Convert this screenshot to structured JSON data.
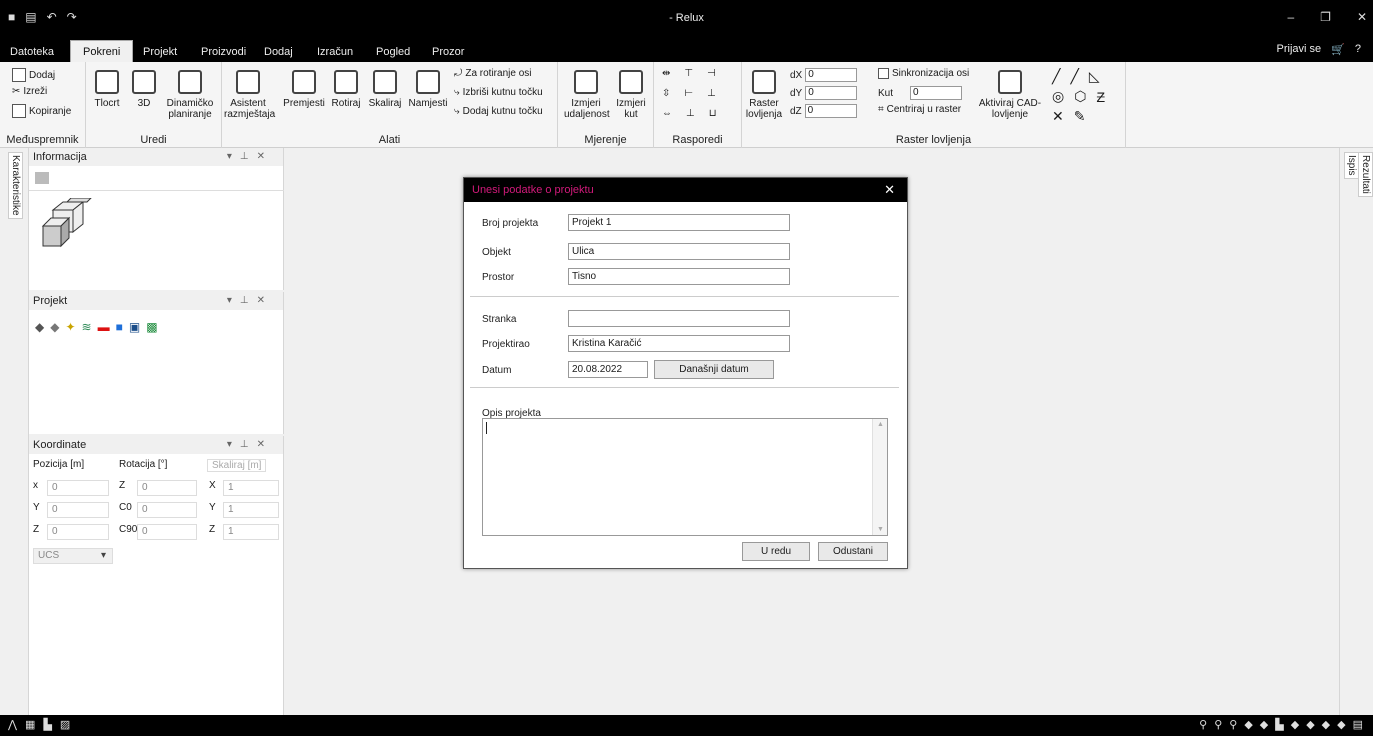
{
  "window": {
    "title": "- Relux",
    "quick_access": [
      "save-icon",
      "print-icon",
      "undo-icon",
      "redo-icon"
    ],
    "controls": [
      "minimize-icon",
      "restore-icon",
      "close-icon"
    ]
  },
  "menu": {
    "tabs": [
      "Datoteka",
      "Pokreni",
      "Projekt",
      "Proizvodi",
      "Dodaj",
      "Izračun",
      "Pogled",
      "Prozor"
    ],
    "active": "Pokreni",
    "signin": "Prijavi se",
    "cart_icon": "cart-icon",
    "help_icon": "help-icon"
  },
  "ribbon": {
    "clipboard": {
      "label": "Međuspremnik",
      "items": [
        "Dodaj",
        "Izreži",
        "Kopiranje"
      ]
    },
    "edit": {
      "label": "Uredi",
      "items": [
        "Tlocrt",
        "3D",
        "Dinamičko planiranje"
      ]
    },
    "tools": {
      "label": "Alati",
      "items": [
        "Asistent razmještaja",
        "Premjesti",
        "Rotiraj",
        "Skaliraj",
        "Namjesti"
      ],
      "rotation": [
        "Za rotiranje osi",
        "Izbriši kutnu točku",
        "Dodaj kutnu točku"
      ]
    },
    "measure": {
      "label": "Mjerenje",
      "items": [
        "Izmjeri udaljenost",
        "Izmjeri kut"
      ]
    },
    "arrange": {
      "label": "Rasporedi"
    },
    "snap": {
      "label": "Raster lovljenja",
      "raster_label": "Raster lovljenja",
      "dx_label": "dX",
      "dx": "0",
      "dy_label": "dY",
      "dy": "0",
      "dz_label": "dZ",
      "dz": "0",
      "sync": "Sinkronizacija osi",
      "angle_label": "Kut",
      "angle": "0",
      "center": "Centriraj u raster",
      "cad": "Aktiviraj CAD-lovljenje"
    }
  },
  "left_tab": "Karakteristike",
  "right_tabs": [
    "Ispis",
    "Rezultati"
  ],
  "panels": {
    "info": {
      "title": "Informacija"
    },
    "project": {
      "title": "Projekt"
    },
    "coords": {
      "title": "Koordinate",
      "pos_header": "Pozicija [m]",
      "rot_header": "Rotacija [°]",
      "scale_header": "Skaliraj [m]",
      "rows": [
        {
          "a": "x",
          "av": "0",
          "b": "Z",
          "bv": "0",
          "c": "X",
          "cv": "1"
        },
        {
          "a": "Y",
          "av": "0",
          "b": "C0",
          "bv": "0",
          "c": "Y",
          "cv": "1"
        },
        {
          "a": "Z",
          "av": "0",
          "b": "C90",
          "bv": "0",
          "c": "Z",
          "cv": "1"
        }
      ],
      "ucs": "UCS"
    }
  },
  "dialog": {
    "title": "Unesi podatke o projektu",
    "broj_label": "Broj projekta",
    "broj": "Projekt 1",
    "objekt_label": "Objekt",
    "objekt": "Ulica",
    "prostor_label": "Prostor",
    "prostor": "Tisno",
    "stranka_label": "Stranka",
    "stranka": "",
    "projektirao_label": "Projektirao",
    "projektirao": "Kristina Karačić",
    "datum_label": "Datum",
    "datum": "20.08.2022",
    "danasnji": "Današnji datum",
    "opis_label": "Opis projekta",
    "opis": "",
    "ok": "U redu",
    "cancel": "Odustani"
  },
  "colors": {
    "accent": "#d21a7b",
    "chrome": "#000000"
  }
}
